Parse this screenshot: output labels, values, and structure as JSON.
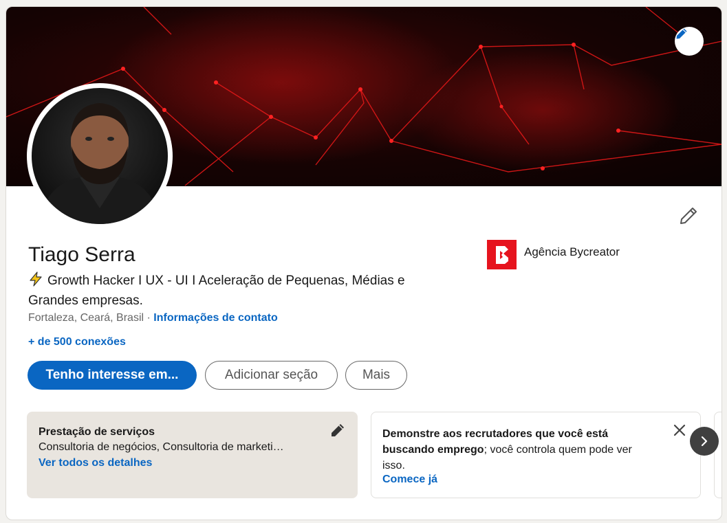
{
  "profile": {
    "name": "Tiago Serra",
    "headline": "Growth Hacker I UX - UI I Aceleração de Pequenas, Médias e Grandes empresas.",
    "location": "Fortaleza, Ceará, Brasil",
    "location_separator": " · ",
    "contact_link": "Informações de contato",
    "connections": "+ de 500 conexões"
  },
  "actions": {
    "primary": "Tenho interesse em...",
    "add_section": "Adicionar seção",
    "more": "Mais"
  },
  "company": {
    "name": "Agência Bycreator"
  },
  "services_card": {
    "title": "Prestação de serviços",
    "text": "Consultoria de negócios, Consultoria de marketi…",
    "link": "Ver todos os detalhes"
  },
  "jobs_card": {
    "text_bold": "Demonstre aos recrutadores que você está buscando emprego",
    "text_rest": "; você controla quem pode ver isso.",
    "link": "Comece já"
  },
  "colors": {
    "accent": "#0a66c2",
    "brand_logo": "#e6141e",
    "banner_red": "#ff1a1a"
  },
  "icons": {
    "banner_edit": "pencil-icon",
    "intro_edit": "pencil-icon",
    "headline": "lightning-icon",
    "services_edit": "pencil-icon",
    "jobs_close": "close-icon",
    "next": "chevron-right-icon"
  }
}
